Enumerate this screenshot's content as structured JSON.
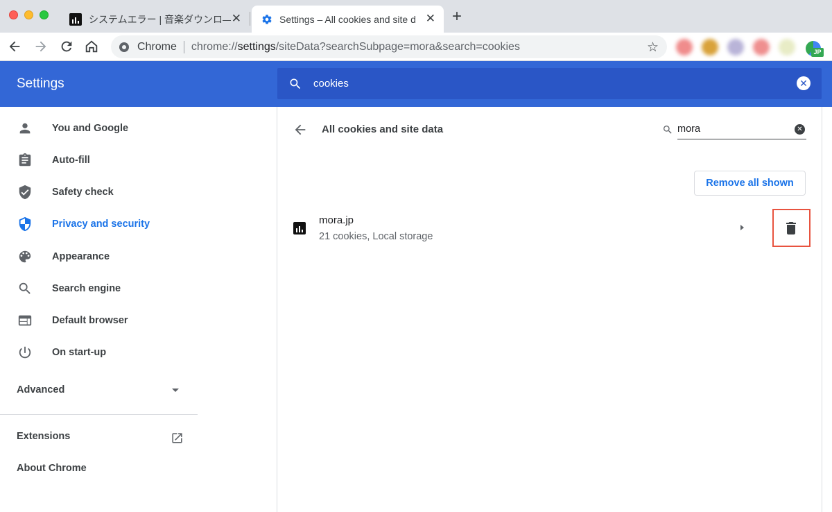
{
  "browser": {
    "tabs": [
      {
        "title": "システムエラー | 音楽ダウンロ―",
        "favicon": "mora-icon",
        "active": false
      },
      {
        "title": "Settings – All cookies and site d",
        "favicon": "gear-icon",
        "active": true
      }
    ],
    "omnibox": {
      "origin_label": "Chrome",
      "url_prefix": "chrome://",
      "url_host": "settings",
      "url_path": "/siteData?searchSubpage=mora&search=cookies"
    },
    "profile_badge": "JP"
  },
  "header": {
    "title": "Settings",
    "search_value": "cookies"
  },
  "sidebar": {
    "items": [
      {
        "label": "You and Google",
        "icon": "person-icon"
      },
      {
        "label": "Auto-fill",
        "icon": "clipboard-icon"
      },
      {
        "label": "Safety check",
        "icon": "shield-check-icon"
      },
      {
        "label": "Privacy and security",
        "icon": "shield-icon",
        "selected": true
      },
      {
        "label": "Appearance",
        "icon": "palette-icon"
      },
      {
        "label": "Search engine",
        "icon": "search-icon"
      },
      {
        "label": "Default browser",
        "icon": "browser-icon"
      },
      {
        "label": "On start-up",
        "icon": "power-icon"
      }
    ],
    "advanced_label": "Advanced",
    "extensions_label": "Extensions",
    "about_label": "About Chrome"
  },
  "subpage": {
    "title": "All cookies and site data",
    "search_value": "mora",
    "remove_all_label": "Remove all shown",
    "sites": [
      {
        "name": "mora.jp",
        "details": "21 cookies, Local storage"
      }
    ]
  },
  "colors": {
    "header_blue": "#3367d6",
    "search_blue": "#2a56c6",
    "accent": "#1a73e8",
    "highlight_red": "#e8533f"
  }
}
